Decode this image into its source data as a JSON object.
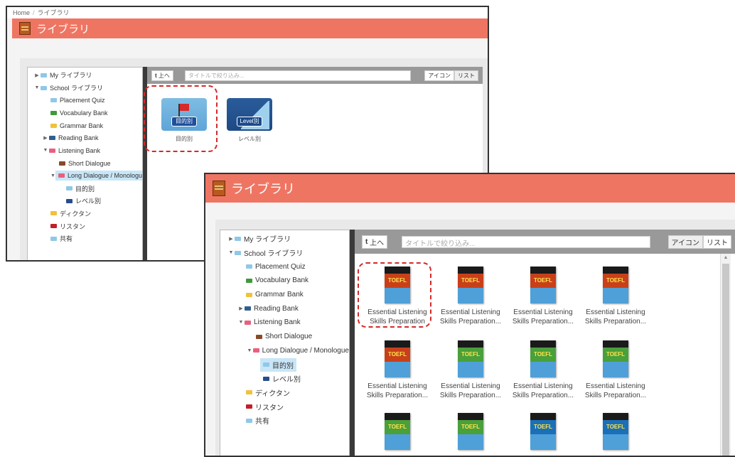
{
  "breadcrumb": {
    "home": "Home",
    "separator": "/",
    "current": "ライブラリ"
  },
  "page_title": "ライブラリ",
  "tree": {
    "my_library": "My ライブラリ",
    "school_library": "School ライブラリ",
    "placement_quiz": "Placement Quiz",
    "vocabulary_bank": "Vocabulary Bank",
    "grammar_bank": "Grammar Bank",
    "reading_bank": "Reading Bank",
    "listening_bank": "Listening Bank",
    "short_dialogue": "Short Dialogue",
    "long_dialogue": "Long Dialogue / Monologue",
    "purpose": "目的別",
    "level": "レベル別",
    "dictation": "ディクタン",
    "listan": "リスタン",
    "shared": "共有"
  },
  "toolbar": {
    "up_icon": "up-arrow-icon",
    "up_label": "上へ",
    "search_placeholder": "タイトルで絞り込み...",
    "view_icon": "アイコン",
    "view_list": "リスト"
  },
  "folders": [
    {
      "badge": "目的別",
      "label": "目的別",
      "icon": "flag-icon"
    },
    {
      "badge": "Level別",
      "label": "レベル別",
      "icon": "stairs-icon"
    }
  ],
  "books": {
    "row1": [
      {
        "line1": "Essential Listening",
        "line2": "Skills Preparation",
        "cover": "red"
      },
      {
        "line1": "Essential Listening",
        "line2": "Skills Preparation...",
        "cover": "red"
      },
      {
        "line1": "Essential Listening",
        "line2": "Skills Preparation...",
        "cover": "red"
      },
      {
        "line1": "Essential Listening",
        "line2": "Skills Preparation...",
        "cover": "red"
      }
    ],
    "row2": [
      {
        "line1": "Essential Listening",
        "line2": "Skills Preparation...",
        "cover": "red"
      },
      {
        "line1": "Essential Listening",
        "line2": "Skills Preparation...",
        "cover": "green"
      },
      {
        "line1": "Essential Listening",
        "line2": "Skills Preparation...",
        "cover": "green"
      },
      {
        "line1": "Essential Listening",
        "line2": "Skills Preparation...",
        "cover": "green"
      }
    ],
    "row3_covers": [
      "green",
      "green",
      "blue",
      "blue"
    ]
  },
  "colors": {
    "title_bar": "#ef7563",
    "highlight_dash": "#d62828",
    "selection": "#c8e6f7"
  }
}
